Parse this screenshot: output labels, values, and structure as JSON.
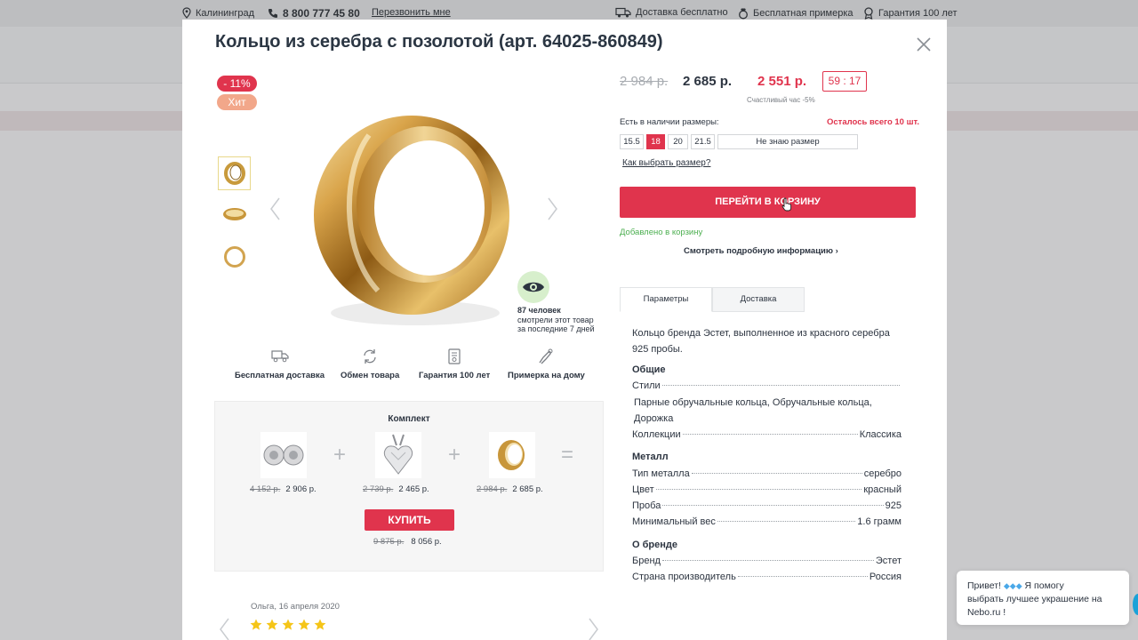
{
  "topbar": {
    "city": "Калининград",
    "phone": "8 800 777 45 80",
    "callback": "Перезвонить мне",
    "delivery": "Доставка бесплатно",
    "fitting": "Бесплатная примерка",
    "warranty": "Гарантия 100 лет"
  },
  "modal": {
    "title": "Кольцо из серебра с позолотой (арт. 64025-860849)",
    "badge_sale": "- 11%",
    "badge_hit": "Хит",
    "views": {
      "count": "87 человек",
      "line2": "смотрели этот товар",
      "line3": "за последние 7 дней"
    },
    "features": [
      {
        "label": "Бесплатная доставка",
        "icon": "truck-icon"
      },
      {
        "label": "Обмен товара",
        "icon": "exchange-icon"
      },
      {
        "label": "Гарантия 100 лет",
        "icon": "certificate-icon"
      },
      {
        "label": "Примерка на дому",
        "icon": "hand-ring-icon"
      }
    ],
    "bundle": {
      "title": "Комплект",
      "items": [
        {
          "old": "4 152 р.",
          "price": "2 906 р."
        },
        {
          "old": "2 739 р.",
          "price": "2 465 р."
        },
        {
          "old": "2 984 р.",
          "price": "2 685 р."
        }
      ],
      "plus": "+",
      "equals": "=",
      "buy": "КУПИТЬ",
      "total_old": "9 875 р.",
      "total": "8 056 р."
    },
    "review": {
      "author": "Ольга, 16 апреля 2020",
      "rating": 5
    },
    "price": {
      "old": "2 984 р.",
      "current": "2 685 р.",
      "happy": "2 551 р.",
      "happy_note": "Счастливый час -5%",
      "timer": "59 : 17"
    },
    "sizes": {
      "label": "Есть в наличии размеры:",
      "left_note": "Осталось всего 10 шт.",
      "options": [
        "15.5",
        "18",
        "20",
        "21.5"
      ],
      "selected": "18",
      "unknown": "Не знаю размер",
      "help": "Как выбрать размер?"
    },
    "cart_button": "ПЕРЕЙТИ В КОРЗИНУ",
    "added_note": "Добавлено в корзину",
    "more_info": "Смотреть подробную информацию",
    "more_chevron": "›",
    "tabs": [
      "Параметры",
      "Доставка"
    ],
    "description": "Кольцо бренда Эстет, выполненное из красного серебра 925 пробы.",
    "params": {
      "general_title": "Общие",
      "styles_label": "Стили",
      "styles_value": "Парные обручальные кольца, Обручальные кольца, Дорожка",
      "collections_label": "Коллекции",
      "collections_value": "Классика",
      "metal_title": "Металл",
      "metal_type_label": "Тип металла",
      "metal_type_value": "серебро",
      "color_label": "Цвет",
      "color_value": "красный",
      "assay_label": "Проба",
      "assay_value": "925",
      "weight_label": "Минимальный вес",
      "weight_value": "1.6 грамм",
      "brand_title": "О бренде",
      "brand_label": "Бренд",
      "brand_value": "Эстет",
      "country_label": "Страна производитель",
      "country_value": "Россия"
    }
  },
  "chat": {
    "line1": "Привет!",
    "line1b": "Я помогу",
    "line2": "выбрать лучшее украшение на",
    "line3": "Nebo.ru !"
  },
  "colors": {
    "accent": "#e0344d",
    "hit": "#f2a78a",
    "success": "#4caf50"
  }
}
